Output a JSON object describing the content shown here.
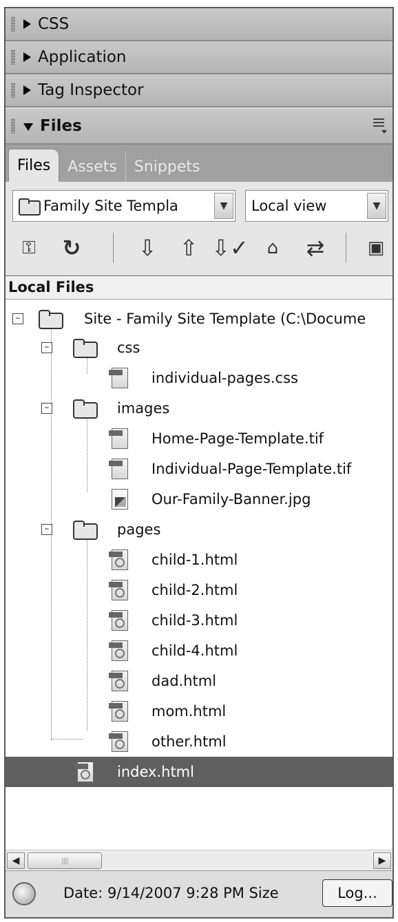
{
  "panel_groups": [
    {
      "label": "CSS",
      "expanded": false
    },
    {
      "label": "Application",
      "expanded": false
    },
    {
      "label": "Tag Inspector",
      "expanded": false
    },
    {
      "label": "Files",
      "expanded": true
    }
  ],
  "tabs": [
    {
      "label": "Files",
      "active": true
    },
    {
      "label": "Assets",
      "active": false
    },
    {
      "label": "Snippets",
      "active": false
    }
  ],
  "toolbar": {
    "site_select": "Family Site Templa",
    "view_select": "Local view",
    "buttons": [
      "connect-icon",
      "refresh-icon",
      "get-files-icon",
      "put-files-icon",
      "check-out-icon",
      "check-in-icon",
      "synchronize-icon",
      "expand-collapse-icon"
    ]
  },
  "tree": {
    "header": "Local Files",
    "root": "Site - Family Site Template (C:\\Docume",
    "folders": [
      {
        "name": "css",
        "files": [
          "individual-pages.css"
        ]
      },
      {
        "name": "images",
        "files": [
          "Home-Page-Template.tif",
          "Individual-Page-Template.tif",
          "Our-Family-Banner.jpg"
        ]
      },
      {
        "name": "pages",
        "files": [
          "child-1.html",
          "child-2.html",
          "child-3.html",
          "child-4.html",
          "dad.html",
          "mom.html",
          "other.html"
        ]
      }
    ],
    "root_files": [
      {
        "name": "index.html",
        "selected": true
      }
    ]
  },
  "status": {
    "text": "Date: 9/14/2007 9:28 PM  Size",
    "log_button": "Log..."
  },
  "colors": {
    "selection": "#5f5f5f",
    "tab_strip": "#a0a0a0"
  }
}
